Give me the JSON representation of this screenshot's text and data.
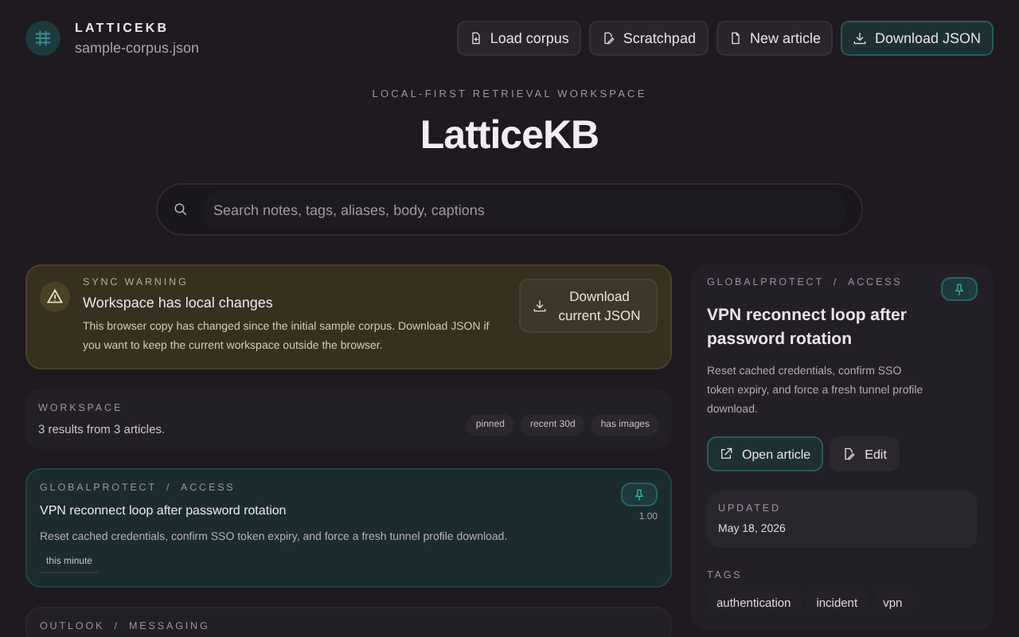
{
  "app": {
    "name": "LATTICEKB",
    "file": "sample-corpus.json"
  },
  "toolbar": [
    {
      "label": "Load corpus",
      "kind": "load",
      "primary": false
    },
    {
      "label": "Scratchpad",
      "kind": "scratch",
      "primary": false
    },
    {
      "label": "New article",
      "kind": "new",
      "primary": false
    },
    {
      "label": "Download JSON",
      "kind": "download",
      "primary": true
    }
  ],
  "hero": {
    "eyebrow": "LOCAL-FIRST RETRIEVAL WORKSPACE",
    "title": "LatticeKB"
  },
  "search": {
    "placeholder": "Search notes, tags, aliases, body, captions"
  },
  "warning": {
    "eyebrow": "SYNC WARNING",
    "title": "Workspace has local changes",
    "body": "This browser copy has changed since the initial sample corpus. Download JSON if you want to keep the current workspace outside the browser.",
    "button": "Download current JSON"
  },
  "workspace": {
    "eyebrow": "WORKSPACE",
    "summary": "3 results from 3 articles.",
    "filters": [
      {
        "label": "pinned",
        "selected": false
      },
      {
        "label": "recent 30d",
        "selected": false
      },
      {
        "label": "has images",
        "selected": false
      }
    ]
  },
  "results": [
    {
      "breadcrumb": "GLOBALPROTECT / ACCESS",
      "title": "VPN reconnect loop after password rotation",
      "summary": "Reset cached credentials, confirm SSO token expiry, and force a fresh tunnel profile download.",
      "score": "1.00",
      "when": "this minute",
      "pinned": true,
      "selected": true
    },
    {
      "breadcrumb": "OUTLOOK / MESSAGING",
      "selected": false
    }
  ],
  "detail": {
    "breadcrumb": "GLOBALPROTECT / ACCESS",
    "pinned": true,
    "title": "VPN reconnect loop after password rotation",
    "summary": "Reset cached credentials, confirm SSO token expiry, and force a fresh tunnel profile download.",
    "actions": [
      {
        "label": "Open article",
        "kind": "open",
        "primary": true
      },
      {
        "label": "Edit",
        "kind": "edit",
        "primary": false
      }
    ],
    "updated_label": "UPDATED",
    "updated": "May 18, 2026",
    "tags_label": "TAGS",
    "tags": [
      "authentication",
      "incident",
      "vpn"
    ]
  }
}
